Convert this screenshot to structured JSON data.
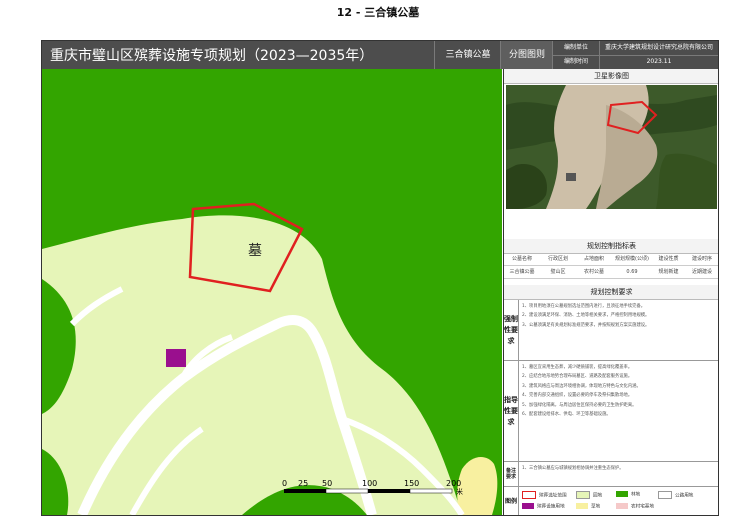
{
  "page_heading": "12 - 三合镇公墓",
  "banner": {
    "title": "重庆市璧山区殡葬设施专项规划（2023—2035年）",
    "place": "三合镇公墓",
    "sheet_type": "分图图则",
    "meta": [
      {
        "key": "编制单位",
        "value": "重庆大学建筑规划设计研究总院有限公司"
      },
      {
        "key": "编制时间",
        "value": "2023.11"
      }
    ]
  },
  "map": {
    "site_label": "墓",
    "scale_bar": {
      "ticks": [
        "0",
        "25",
        "50",
        "100",
        "150",
        "200"
      ],
      "unit": "米"
    },
    "colors": {
      "forest": "#33a500",
      "grass": "#e6f5b8",
      "road": "#ffffff",
      "site_outline": "#e02020",
      "purple": "#9a0f8e",
      "yellow": "#f8f0a0"
    }
  },
  "panel": {
    "satellite_title": "卫星影像图",
    "index_title": "规划控制指标表",
    "index_header": [
      "公墓名称",
      "行政区划",
      "占地面积",
      "规划规模(公顷)",
      "建设性质",
      "建设时序"
    ],
    "index_row": [
      "三合镇公墓",
      "璧山区",
      "农村公墓",
      "0.69",
      "规划新建",
      "近期建设"
    ],
    "requirements_title": "规划控制要求",
    "blocks": [
      {
        "label": "强制性要求",
        "items": [
          "1、项目用地须在公墓规划选址范围内进行，且须征地手续完备。",
          "2、建设须满足环保、消防、土地等相关要求，严格控制用地规模。",
          "3、公墓须满足有关规划标准规范要求，并按照规划方案实施建设。"
        ]
      },
      {
        "label": "指导性要求",
        "items": [
          "1、墓区宜采用生态葬，减少硬质铺装，提高绿化覆盖率。",
          "2、应结合地形地势合理布局墓区、道路及配套服务设施。",
          "3、建筑风格应与周边环境相协调，体现地方特色与文化内涵。",
          "4、完善内部交通组织，设置必要的停车及祭扫集散场地。",
          "5、加强绿化隔离，与周边居住区保持必要的卫生防护距离。",
          "6、配套建设给排水、供电、环卫等基础设施。"
        ]
      },
      {
        "label": "备注要求",
        "items": [
          "1、三合镇公墓应与城镇规划相协调并注重生态保护。"
        ]
      }
    ],
    "legend_label": "图例",
    "legend": [
      {
        "name": "殡葬选址范围",
        "color": "#e02020"
      },
      {
        "name": "园地",
        "color": "#e6f5b8"
      },
      {
        "name": "林地",
        "color": "#33a500"
      },
      {
        "name": "公路用地",
        "color": "#ffffff"
      },
      {
        "name": "殡葬设施用地",
        "color": "#9a0f8e"
      },
      {
        "name": "草地",
        "color": "#f8f0a0"
      },
      {
        "name": "农村宅基地",
        "color": "#f5c9c9"
      }
    ]
  }
}
